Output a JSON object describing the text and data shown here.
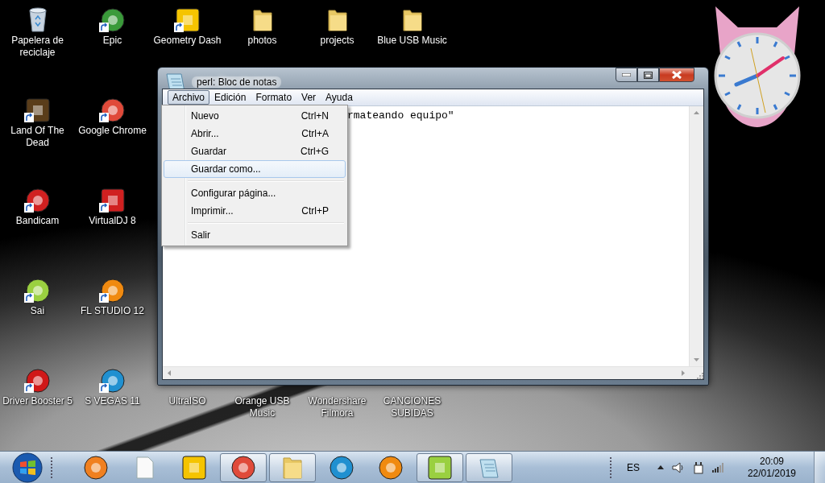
{
  "desktop": {
    "left_columns": [
      [
        {
          "label": "Papelera de reciclaje",
          "kind": "recycle",
          "shortcut": false
        },
        {
          "label": "Land Of The Dead",
          "kind": "app-square",
          "color": "#5a3d1a",
          "shortcut": true
        },
        {
          "label": "Bandicam",
          "kind": "app-round",
          "color": "#d02020",
          "shortcut": true
        },
        {
          "label": "Sai",
          "kind": "app-round",
          "color": "#9ad040",
          "shortcut": true
        },
        {
          "label": "Driver Booster 5",
          "kind": "app-round",
          "color": "#d01818",
          "shortcut": true
        }
      ],
      [
        {
          "label": "Epic",
          "kind": "app-round",
          "color": "#3a9a3a",
          "shortcut": true
        },
        {
          "label": "Google Chrome",
          "kind": "app-round",
          "color": "#e04a3a",
          "shortcut": true
        },
        {
          "label": "VirtualDJ 8",
          "kind": "app-square",
          "color": "#d02020",
          "shortcut": true
        },
        {
          "label": "FL STUDIO 12",
          "kind": "app-round",
          "color": "#f08a10",
          "shortcut": true
        },
        {
          "label": "S VEGAS 11",
          "kind": "app-round",
          "color": "#2090d0",
          "shortcut": true
        }
      ]
    ],
    "top_row": [
      {
        "label": "Geometry Dash",
        "kind": "app-square",
        "color": "#f5c400",
        "shortcut": true
      },
      {
        "label": "photos",
        "kind": "folder",
        "shortcut": false
      },
      {
        "label": "projects",
        "kind": "folder",
        "shortcut": false
      },
      {
        "label": "Blue USB Music",
        "kind": "folder",
        "shortcut": false
      }
    ],
    "bottom_row": [
      {
        "label": "UltraISO"
      },
      {
        "label": "Orange USB Music"
      },
      {
        "label": "Wondershare Filmora"
      },
      {
        "label": "CANCIONES SUBIDAS"
      }
    ]
  },
  "window": {
    "title": "perl: Bloc de notas",
    "menu_bar": [
      {
        "label": "Archivo",
        "selected": true
      },
      {
        "label": "Edición",
        "selected": false
      },
      {
        "label": "Formato",
        "selected": false
      },
      {
        "label": "Ver",
        "selected": false
      },
      {
        "label": "Ayuda",
        "selected": false
      }
    ],
    "open_menu": [
      {
        "kind": "command",
        "label": "Nuevo",
        "shortcut": "Ctrl+N",
        "selected": false
      },
      {
        "kind": "command",
        "label": "Abrir...",
        "shortcut": "Ctrl+A",
        "selected": false
      },
      {
        "kind": "command",
        "label": "Guardar",
        "shortcut": "Ctrl+G",
        "selected": false
      },
      {
        "kind": "command",
        "label": "Guardar como...",
        "selected": true
      },
      {
        "kind": "separator"
      },
      {
        "kind": "command",
        "label": "Configurar página...",
        "selected": false
      },
      {
        "kind": "command",
        "label": "Imprimir...",
        "shortcut": "Ctrl+P",
        "selected": false
      },
      {
        "kind": "separator"
      },
      {
        "kind": "command",
        "label": "Salir",
        "selected": false
      }
    ],
    "editor_text": "rmateando equipo\""
  },
  "taskbar": {
    "items": [
      {
        "kind": "app-round",
        "color": "#f08020",
        "running": false
      },
      {
        "kind": "document",
        "running": false
      },
      {
        "kind": "app-square",
        "color": "#f5c400",
        "running": false
      },
      {
        "kind": "app-round",
        "color": "#e04a3a",
        "running": true
      },
      {
        "kind": "folder",
        "running": true
      },
      {
        "kind": "app-round",
        "color": "#2090d0",
        "running": false
      },
      {
        "kind": "app-round",
        "color": "#f08a10",
        "running": false
      },
      {
        "kind": "app-square",
        "color": "#9ad040",
        "running": true
      },
      {
        "kind": "notepad",
        "running": true
      }
    ],
    "language": "ES",
    "time": "20:09",
    "date": "22/01/2019"
  }
}
